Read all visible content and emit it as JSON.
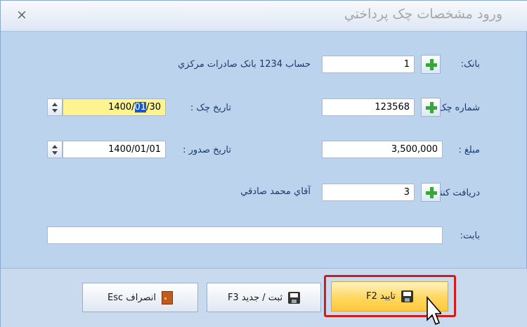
{
  "window": {
    "title": "ورود مشخصات چک پرداختي",
    "close_glyph": "×"
  },
  "form": {
    "bank": {
      "label": "بانک:",
      "value": "1",
      "description": "حساب 1234 بانک صادرات مرکزي"
    },
    "check_number": {
      "label": "شماره چک :",
      "value": "123568"
    },
    "check_date": {
      "label": "تاريخ چک :",
      "value_prefix": "1400/",
      "value_selected": "01",
      "value_suffix": "/30"
    },
    "amount": {
      "label": "مبلغ :",
      "value": "3,500,000"
    },
    "issue_date": {
      "label": "تاريخ صدور :",
      "value": "1400/01/01"
    },
    "receiver": {
      "label": "دريافت کننده :",
      "value": "3",
      "description": "آقاي محمد صادقي"
    },
    "regarding": {
      "label": "بابت:",
      "value": ""
    }
  },
  "buttons": {
    "confirm": {
      "label": "تاييد F2",
      "icon": "floppy-disk-icon"
    },
    "save_new": {
      "label": "ثبت / جديد F3",
      "icon": "floppy-disk-icon"
    },
    "cancel": {
      "label": "انصراف Esc",
      "icon": "exit-door-icon"
    }
  },
  "colors": {
    "highlight_field": "#fdf391",
    "focus_ring": "#d21b1b",
    "add_icon": "#3aa53a"
  }
}
